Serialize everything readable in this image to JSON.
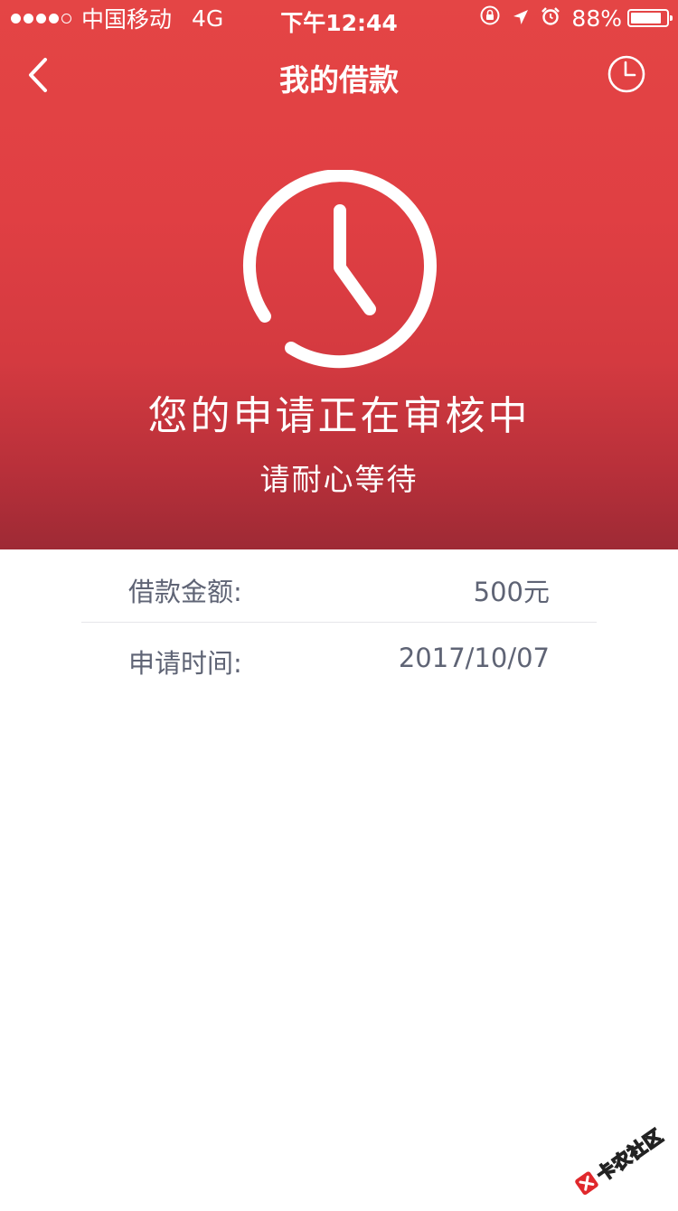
{
  "status_bar": {
    "carrier": "中国移动",
    "network": "4G",
    "time": "下午12:44",
    "battery_percent": "88%",
    "battery_level": 0.88,
    "signal_bars_filled": 4,
    "signal_bars_total": 5
  },
  "nav": {
    "title": "我的借款"
  },
  "status": {
    "title": "您的申请正在审核中",
    "subtitle": "请耐心等待"
  },
  "details": {
    "amount_label": "借款金额:",
    "amount_value": "500元",
    "time_label": "申请时间:",
    "time_value": "2017/10/07"
  },
  "watermark": {
    "text": "卡农社区"
  },
  "colors": {
    "header_top": "#e44545",
    "header_bottom": "#9e2a35",
    "text_gray": "#5f6475",
    "divider": "#e6e6ea"
  }
}
